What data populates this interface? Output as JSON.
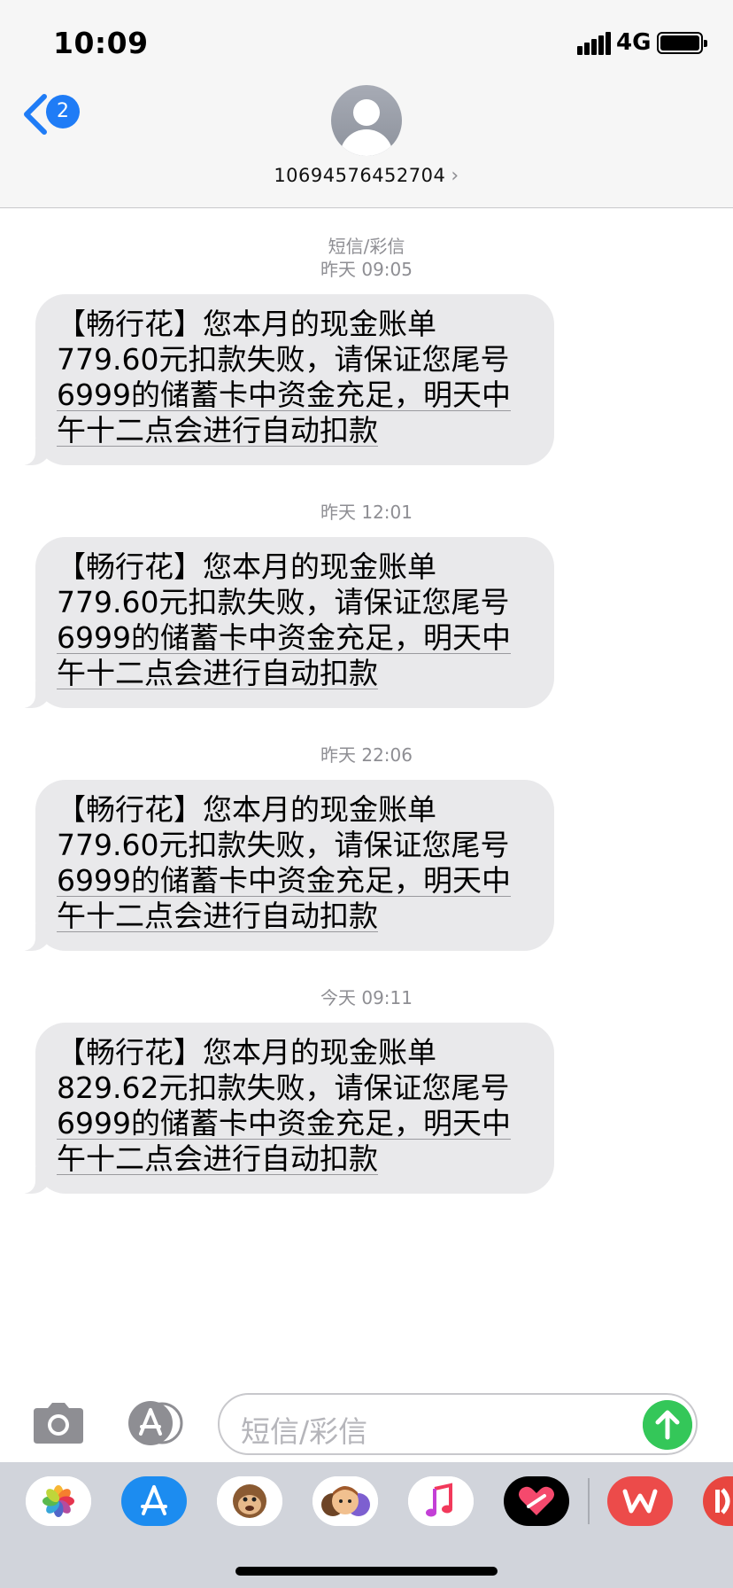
{
  "status_bar": {
    "time": "10:09",
    "network": "4G",
    "battery_level": 1.0
  },
  "nav": {
    "back_badge": "2",
    "contact_number": "10694576452704",
    "contact_chevron": "›"
  },
  "conversation": {
    "message_type": "短信/彩信",
    "messages": [
      {
        "timestamp": "昨天 09:05",
        "lines": [
          "【畅行花】您本月的现金账单",
          "779.60元扣款失败，请保证您尾号",
          "6999的储蓄卡中资金充足，明天中",
          "午十二点会进行自动扣款"
        ]
      },
      {
        "timestamp": "昨天 12:01",
        "lines": [
          "【畅行花】您本月的现金账单",
          "779.60元扣款失败，请保证您尾号",
          "6999的储蓄卡中资金充足，明天中",
          "午十二点会进行自动扣款"
        ]
      },
      {
        "timestamp": "昨天 22:06",
        "lines": [
          "【畅行花】您本月的现金账单",
          "779.60元扣款失败，请保证您尾号",
          "6999的储蓄卡中资金充足，明天中",
          "午十二点会进行自动扣款"
        ]
      },
      {
        "timestamp": "今天 09:11",
        "lines": [
          "【畅行花】您本月的现金账单",
          "829.62元扣款失败，请保证您尾号",
          "6999的储蓄卡中资金充足，明天中",
          "午十二点会进行自动扣款"
        ]
      }
    ]
  },
  "input_bar": {
    "placeholder": "短信/彩信"
  },
  "app_drawer": {
    "apps": [
      "photos-icon",
      "app-store-icon",
      "animoji-icon",
      "memoji-icon",
      "music-icon",
      "digital-touch-icon",
      "wps-icon",
      "app-icon-partial"
    ]
  },
  "colors": {
    "accent": "#1f7cf6",
    "send": "#34c759",
    "bubble": "#e9e9eb",
    "timestamp": "#8e8e93"
  }
}
